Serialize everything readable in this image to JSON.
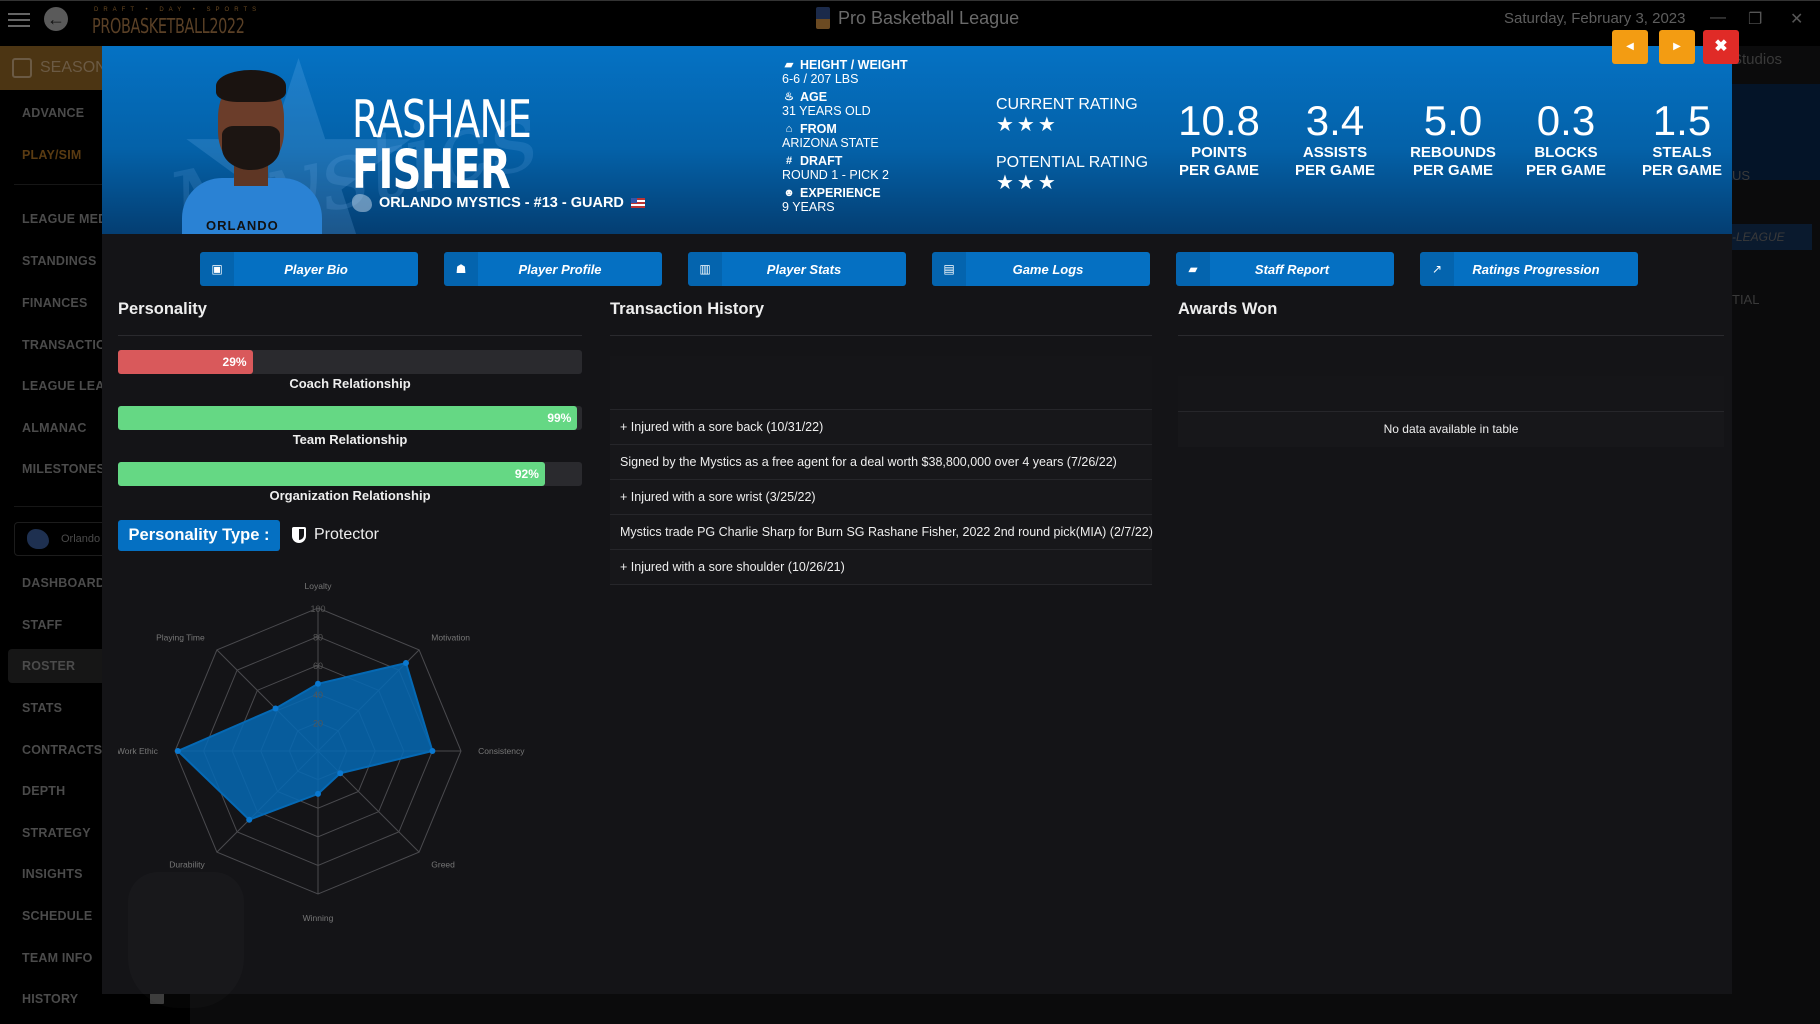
{
  "topbar": {
    "logo_tagline": "DRAFT • DAY • SPORTS",
    "logo_text": "PROBASKETBALL2022",
    "app_title": "Pro Basketball League",
    "date": "Saturday, February 3, 2023",
    "minimize_glyph": "—",
    "restore_glyph": "❐",
    "close_glyph": "✕"
  },
  "sidebar": {
    "section": "SEASON",
    "season_items": [
      "ADVANCE",
      "PLAY/SIM"
    ],
    "league_items": [
      "LEAGUE MEDIA",
      "STANDINGS",
      "FINANCES",
      "TRANSACTIONS",
      "LEAGUE LEADERS",
      "ALMANAC",
      "MILESTONES"
    ],
    "team_name": "Orlando",
    "team_items": [
      "DASHBOARD",
      "STAFF",
      "ROSTER",
      "STATS",
      "CONTRACTS",
      "DEPTH",
      "STRATEGY",
      "INSIGHTS",
      "SCHEDULE",
      "TEAM INFO",
      "HISTORY"
    ],
    "active_item": "PLAY/SIM",
    "selected_item": "ROSTER"
  },
  "background": {
    "studios": "Studios",
    "us_text": "US",
    "league_tab": "-LEAGUE",
    "col_header": "TIAL"
  },
  "player": {
    "first_name": "RASHANE",
    "last_name": "FISHER",
    "team_line": "ORLANDO MYSTICS - #13 - GUARD",
    "jersey_text": "ORLANDO",
    "bio": [
      {
        "icon": "ruler-icon",
        "label": "HEIGHT / WEIGHT",
        "value": "6-6 / 207 LBS"
      },
      {
        "icon": "cake-icon",
        "label": "AGE",
        "value": "31 YEARS OLD"
      },
      {
        "icon": "school-icon",
        "label": "FROM",
        "value": "ARIZONA STATE"
      },
      {
        "icon": "hash-icon",
        "label": "DRAFT",
        "value": "ROUND 1 - PICK 2"
      },
      {
        "icon": "user-clock-icon",
        "label": "EXPERIENCE",
        "value": "9 YEARS"
      }
    ],
    "current_rating_label": "CURRENT RATING",
    "current_rating_stars": 3,
    "current_rating_display": "★★★",
    "potential_rating_label": "POTENTIAL RATING",
    "potential_rating_stars": 3,
    "potential_rating_display": "★★★",
    "stats": [
      {
        "value": "10.8",
        "label1": "POINTS",
        "label2": "PER GAME"
      },
      {
        "value": "3.4",
        "label1": "ASSISTS",
        "label2": "PER GAME"
      },
      {
        "value": "5.0",
        "label1": "REBOUNDS",
        "label2": "PER GAME"
      },
      {
        "value": "0.3",
        "label1": "BLOCKS",
        "label2": "PER GAME"
      },
      {
        "value": "1.5",
        "label1": "STEALS",
        "label2": "PER GAME"
      }
    ]
  },
  "modal_controls": {
    "prev_glyph": "◀",
    "next_glyph": "▶",
    "close_glyph": "✖"
  },
  "tabs": [
    {
      "label": "Player Bio",
      "icon": "id-card-icon",
      "glyph": "▣"
    },
    {
      "label": "Player Profile",
      "icon": "reader-icon",
      "glyph": "☗"
    },
    {
      "label": "Player Stats",
      "icon": "bar-chart-icon",
      "glyph": "▥"
    },
    {
      "label": "Game Logs",
      "icon": "clipboard-icon",
      "glyph": "▤"
    },
    {
      "label": "Staff Report",
      "icon": "comment-icon",
      "glyph": "▰"
    },
    {
      "label": "Ratings Progression",
      "icon": "line-chart-icon",
      "glyph": "↗"
    }
  ],
  "personality": {
    "title": "Personality",
    "bars": [
      {
        "label": "Coach Relationship",
        "percent": 29,
        "display": "29%",
        "color": "#d9595b"
      },
      {
        "label": "Team Relationship",
        "percent": 99,
        "display": "99%",
        "color": "#65d884"
      },
      {
        "label": "Organization Relationship",
        "percent": 92,
        "display": "92%",
        "color": "#65d884"
      }
    ],
    "type_label": "Personality Type :",
    "type_value": "Protector"
  },
  "chart_data": {
    "type": "radar",
    "categories": [
      "Loyalty",
      "Motivation",
      "Consistency",
      "Greed",
      "Winning",
      "Durability",
      "Work Ethic",
      "Playing Time"
    ],
    "values": [
      47,
      87,
      80,
      22,
      30,
      68,
      98,
      42
    ],
    "ticks": [
      "20",
      "40",
      "60",
      "80",
      "100"
    ],
    "range": [
      0,
      100
    ],
    "fill_color": "#0569b4"
  },
  "transactions": {
    "title": "Transaction History",
    "rows": [
      "+ Injured with a sore back (10/31/22)",
      "Signed by the Mystics as a free agent for a deal worth $38,800,000 over 4 years (7/26/22)",
      "+ Injured with a sore wrist (3/25/22)",
      "Mystics trade PG Charlie Sharp for Burn SG Rashane Fisher, 2022 2nd round pick(MIA) (2/7/22)",
      "+ Injured with a sore shoulder (10/26/21)"
    ]
  },
  "awards": {
    "title": "Awards Won",
    "empty_text": "No data available in table"
  }
}
